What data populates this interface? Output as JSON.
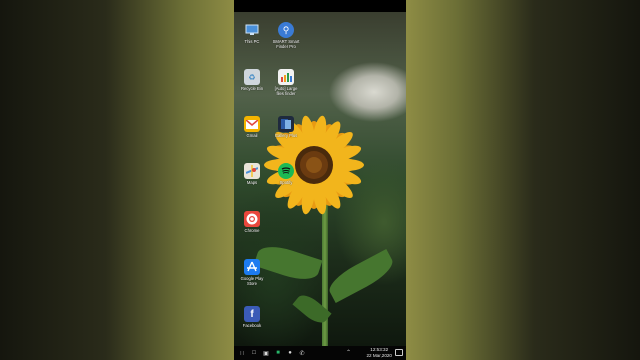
{
  "desktop": {
    "icons": [
      {
        "label": "This PC",
        "icon": "monitor-icon",
        "color": "#4a90d9"
      },
      {
        "label": "SMART Smart Finder Pro",
        "icon": "magnifier-icon",
        "color": "#3a7bd5"
      },
      {
        "label": "Recycle Bin",
        "icon": "recycle-bin-icon",
        "color": "#cfd6dc"
      },
      {
        "label": "[Auto] Large files finder",
        "icon": "bar-chart-icon",
        "color": "#f2f2f2"
      },
      {
        "label": "Gmail",
        "icon": "gmail-icon",
        "color": "#e1463d"
      },
      {
        "label": "Gallery Plus",
        "icon": "gallery-icon",
        "color": "#2b5aa5"
      },
      {
        "label": "Maps",
        "icon": "maps-icon",
        "color": "#e9e4d8"
      },
      {
        "label": "Spotify",
        "icon": "spotify-icon",
        "color": "#1db954"
      },
      {
        "label": "Chrome",
        "icon": "chrome-icon",
        "color": "#e9473c"
      },
      {
        "label": "Google Play Store",
        "icon": "app-store-icon",
        "color": "#1d7bf0"
      },
      {
        "label": "Facebook",
        "icon": "facebook-icon",
        "color": "#3b5bb7"
      }
    ]
  },
  "taskbar": {
    "time": "12:53:32",
    "date": "22 Mar,2020"
  }
}
